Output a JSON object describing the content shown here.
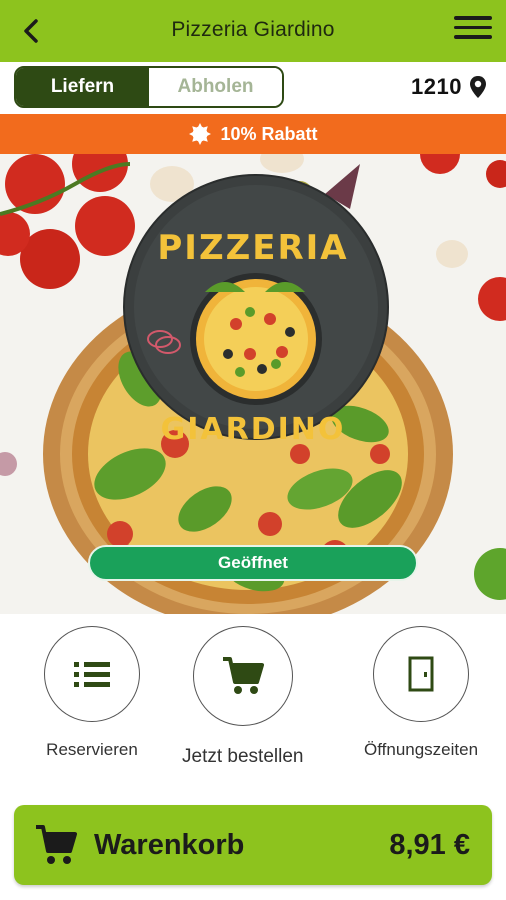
{
  "header": {
    "title": "Pizzeria Giardino",
    "back_icon": "chevron-left-icon",
    "menu_icon": "hamburger-menu-icon"
  },
  "delivery": {
    "options": [
      "Liefern",
      "Abholen"
    ],
    "selected": "Liefern",
    "postcode": "1210",
    "location_icon": "map-pin-icon"
  },
  "discount": {
    "text": "10% Rabatt",
    "icon": "badge-icon"
  },
  "hero": {
    "logo_top": "PIZZERIA",
    "logo_bottom": "GIARDINO",
    "status": "Geöffnet"
  },
  "actions": [
    {
      "label": "Reservieren",
      "icon": "list-icon"
    },
    {
      "label": "Jetzt bestellen",
      "icon": "cart-icon"
    },
    {
      "label": "Öffnungszeiten",
      "icon": "door-icon"
    }
  ],
  "cart": {
    "label": "Warenkorb",
    "total": "8,91 €",
    "icon": "cart-icon"
  },
  "colors": {
    "brand_green": "#8dc31e",
    "dark_green": "#2e4a14",
    "discount_orange": "#f26b1d",
    "open_green": "#1aa15a"
  }
}
